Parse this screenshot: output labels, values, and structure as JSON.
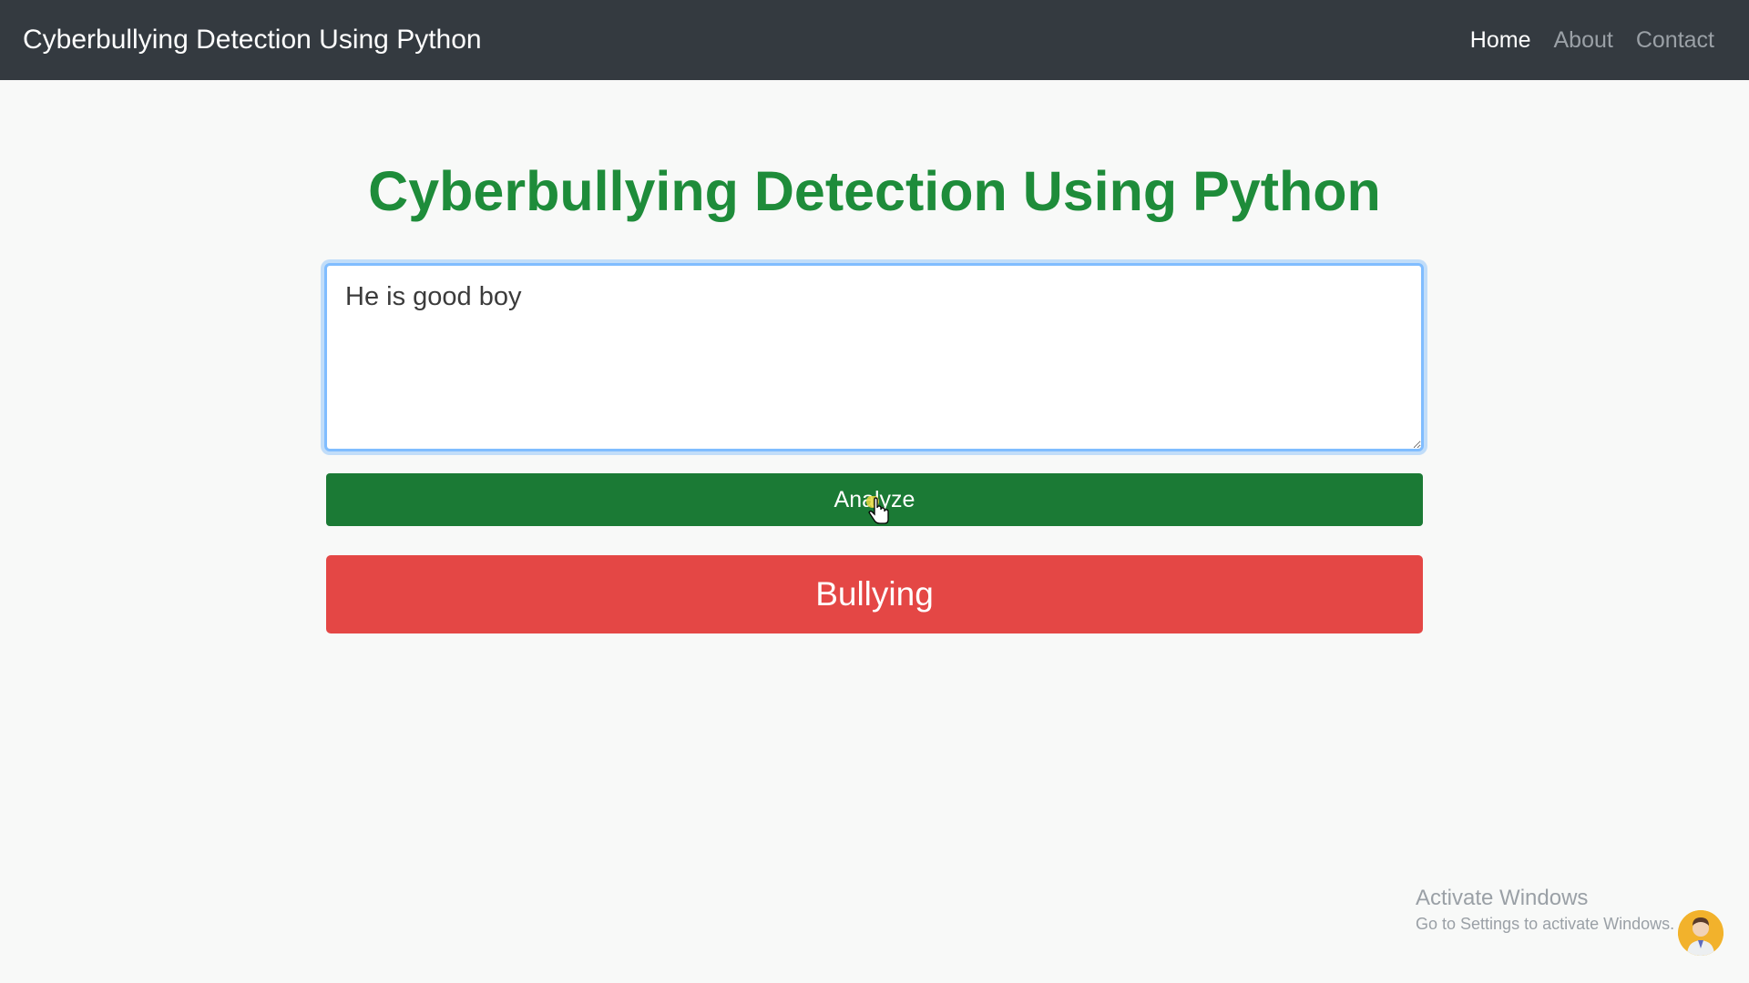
{
  "navbar": {
    "brand": "Cyberbullying Detection Using Python",
    "links": [
      {
        "label": "Home",
        "active": true
      },
      {
        "label": "About",
        "active": false
      },
      {
        "label": "Contact",
        "active": false
      }
    ]
  },
  "main": {
    "title": "Cyberbullying Detection Using Python",
    "input_value": "He is good boy",
    "analyze_label": "Analyze",
    "result_label": "Bullying"
  },
  "watermark": {
    "title": "Activate Windows",
    "subtitle": "Go to Settings to activate Windows."
  },
  "colors": {
    "navbar_bg": "#343a40",
    "title_green": "#1e8c3a",
    "analyze_button": "#1b7a35",
    "result_red": "#e44745",
    "focus_border": "#80bdff"
  },
  "icons": {
    "cursor": "hand-pointer-icon",
    "avatar": "user-avatar-icon"
  }
}
